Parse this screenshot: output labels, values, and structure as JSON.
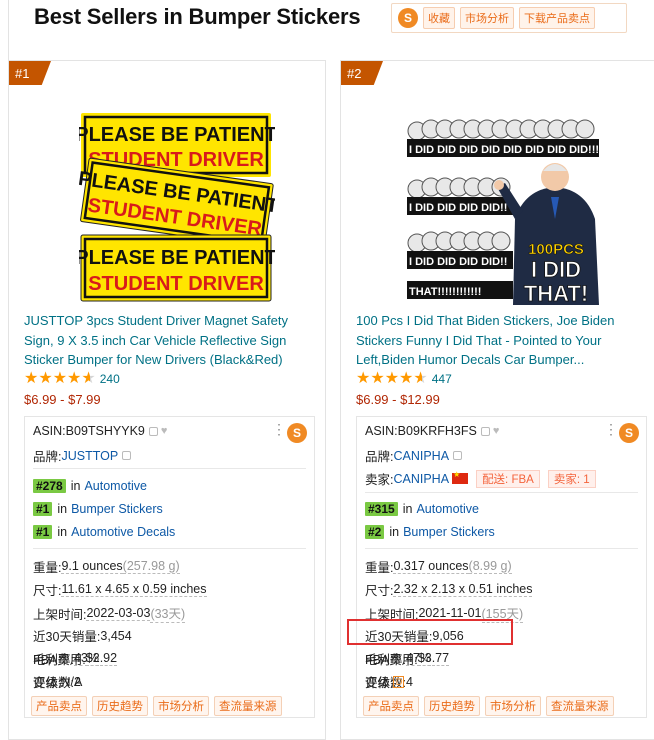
{
  "page": {
    "title": "Best Sellers in Bumper Stickers"
  },
  "toolbar": {
    "logo": "S",
    "buttons": [
      "收藏",
      "市场分析",
      "下载产品卖点"
    ]
  },
  "products": [
    {
      "rank_badge": "#1",
      "image_alt": "PLEASE BE PATIENT STUDENT DRIVER magnets",
      "title": "JUSTTOP 3pcs Student Driver Magnet Safety Sign, 9 X 3.5 inch Car Vehicle Reflective Sign Sticker Bumper for New Drivers (Black&Red)",
      "rating": 4.5,
      "review_count": "240",
      "price": "$6.99 - $7.99",
      "info": {
        "asin_label": "ASIN: ",
        "asin": "B09TSHYYK9",
        "brand_label": "品牌: ",
        "brand": "JUSTTOP",
        "ranks": [
          {
            "num": "#278",
            "in": "in",
            "cat": "Automotive"
          },
          {
            "num": "#1",
            "in": "in",
            "cat": "Bumper Stickers"
          },
          {
            "num": "#1",
            "in": "in",
            "cat": "Automotive Decals"
          }
        ],
        "weight_label": "重量: ",
        "weight": "9.1 ounces",
        "weight_alt": "(257.98 g)",
        "size_label": "尺寸: ",
        "size": "11.61 x 4.65 x 0.59 inches",
        "date_label": "上架时间: ",
        "date": "2022-03-03",
        "date_alt": "(33天)",
        "sales_label": "近30天销量: ",
        "sales": "3,454",
        "fba_label": "FBA费用: ",
        "fba": "$2.92",
        "margin_label": "毛利率: ",
        "margin": "43%",
        "variants_label": "变体数: ",
        "variants": "2",
        "grade_label": "评级:",
        "grade": "N/A",
        "buttons": [
          "产品卖点",
          "历史趋势",
          "市场分析",
          "查流量来源"
        ]
      }
    },
    {
      "rank_badge": "#2",
      "image_alt": "I DID THAT stickers 100PCS",
      "title": "100 Pcs I Did That Biden Stickers, Joe Biden Stickers Funny I Did That - Pointed to Your Left,Biden Humor Decals Car Bumper...",
      "rating": 4.5,
      "review_count": "447",
      "price": "$6.99 - $12.99",
      "info": {
        "asin_label": "ASIN: ",
        "asin": "B09KRFH3FS",
        "brand_label": "品牌: ",
        "brand": "CANIPHA",
        "seller_label": "卖家: ",
        "seller": "CANIPHA",
        "delivery_tag": "配送: FBA",
        "seller_count_tag": "卖家: 1",
        "ranks": [
          {
            "num": "#315",
            "in": "in",
            "cat": "Automotive"
          },
          {
            "num": "#2",
            "in": "in",
            "cat": "Bumper Stickers"
          }
        ],
        "weight_label": "重量: ",
        "weight": "0.317 ounces",
        "weight_alt": "(8.99 g)",
        "size_label": "尺寸: ",
        "size": "2.32 x 2.13 x 0.51 inches",
        "date_label": "上架时间: ",
        "date": "2021-11-01",
        "date_alt": "(155天)",
        "sales_label": "近30天销量: ",
        "sales": "9,056",
        "fba_label": "FBA费用: ",
        "fba": "$3.77",
        "margin_label": "毛利率: ",
        "margin": "47%",
        "variants_label": "变体数: ",
        "variants": "4",
        "grade_label": "评级: ",
        "grade": "D",
        "buttons": [
          "产品卖点",
          "历史趋势",
          "市场分析",
          "查流量来源"
        ]
      }
    }
  ],
  "colors": {
    "link": "#007185",
    "price": "#b12704",
    "badge": "#c45500",
    "rank_green": "#7ac943",
    "accent": "#f08a24",
    "highlight": "#e03030"
  }
}
